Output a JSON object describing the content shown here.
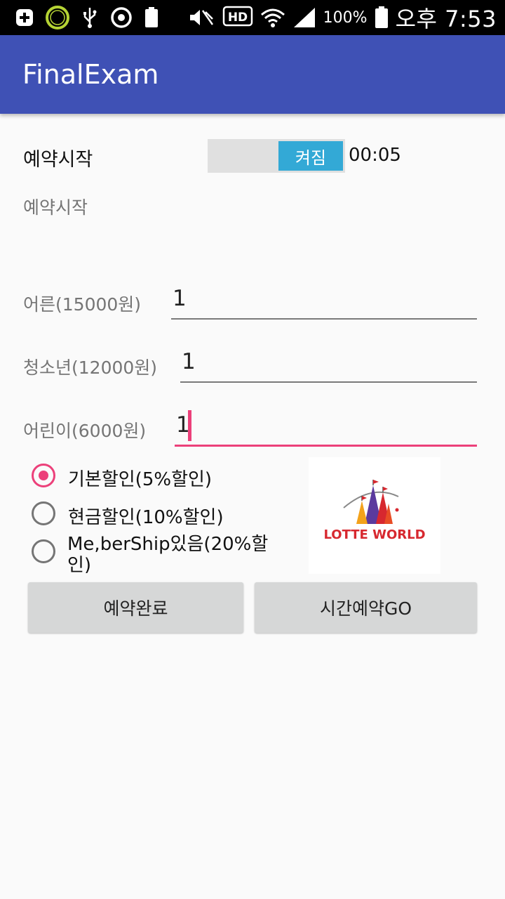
{
  "status_bar": {
    "battery_percent": "100%",
    "time": "오후 7:53",
    "left_icons": [
      "plus-badge-icon",
      "battery-100-badge-icon",
      "usb-icon",
      "sync-icon",
      "battery-small-icon"
    ],
    "right_icons": [
      "mute-icon",
      "hd-icon",
      "wifi-icon",
      "signal-icon",
      "battery-icon"
    ]
  },
  "app_bar": {
    "title": "FinalExam"
  },
  "reservation": {
    "label": "예약시작",
    "toggle_label": "켜짐",
    "timer": "00:05",
    "status_text": "예약시작"
  },
  "fields": [
    {
      "label": "어른(15000원)",
      "value": "1"
    },
    {
      "label": "청소년(12000원)",
      "value": "1"
    },
    {
      "label": "어린이(6000원)",
      "value": "1"
    }
  ],
  "discounts": {
    "selected": "기본할인(5%할인)",
    "options": [
      {
        "label": "기본할인(5%할인)"
      },
      {
        "label": "현금할인(10%할인)"
      },
      {
        "label": "Me,berShip있음(20%할인)"
      }
    ]
  },
  "logo": {
    "text": "LOTTE WORLD"
  },
  "buttons": {
    "complete_label": "예약완료",
    "time_reserve_label": "시간예약GO"
  },
  "colors": {
    "app_bar": "#3f51b5",
    "accent": "#ec407a",
    "toggle_on": "#33a9d6",
    "button_bg": "#d6d7d7"
  }
}
